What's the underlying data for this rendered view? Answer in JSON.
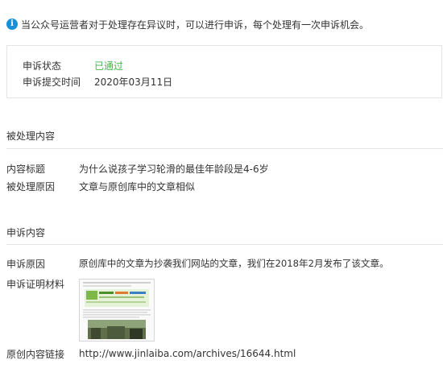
{
  "notice": {
    "icon": "info-icon",
    "text": "当公众号运营者对于处理存在异议时，可以进行申诉，每个处理有一次申诉机会。"
  },
  "status": {
    "state_label": "申诉状态",
    "state_value": "已通过",
    "state_color": "#44b549",
    "time_label": "申诉提交时间",
    "time_value": "2020年03月11日"
  },
  "processed": {
    "title": "被处理内容",
    "content_title_label": "内容标题",
    "content_title_value": "为什么说孩子学习轮滑的最佳年龄段是4-6岁",
    "reason_label": "被处理原因",
    "reason_value": "文章与原创库中的文章相似"
  },
  "appeal": {
    "title": "申诉内容",
    "reason_label": "申诉原因",
    "reason_value": "原创库中的文章为抄袭我们网站的文章，我们在2018年2月发布了该文章。",
    "evidence_label": "申诉证明材料",
    "link_label": "原创内容链接",
    "link_value": "http://www.jinlaiba.com/archives/16644.html"
  },
  "colors": {
    "info_blue": "#1a8fd4",
    "success_green": "#44b549",
    "divider": "#e4e4e4"
  }
}
